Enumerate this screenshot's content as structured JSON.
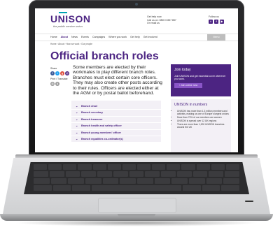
{
  "site": {
    "logo": "UNISON",
    "tagline": "the public service union",
    "help": {
      "title": "Get help now",
      "call": "Call us on: 0800 0 857 857",
      "email": "Or email us"
    },
    "follow_label": "Follow us",
    "social_icons": [
      "twitter-icon",
      "facebook-icon",
      "youtube-icon"
    ]
  },
  "nav": {
    "items": [
      "Home",
      "About",
      "News",
      "Events",
      "Campaigns",
      "Where you work",
      "Get help",
      "Get involved"
    ],
    "active": "About",
    "menu_label": "Menu"
  },
  "breadcrumb": [
    "Home",
    "About",
    "How we work",
    "Our people"
  ],
  "page": {
    "title": "Official branch roles",
    "share_label": "Share",
    "print_label": "Print / Translate",
    "intro": "Some members are elected by their workmates to play different branch roles. Branches must elect certain core officers. They may also create other posts according to their rules. Officers are elected either at the AGM or by postal ballot beforehand."
  },
  "accordion": [
    "Branch chair",
    "Branch secretary",
    "Branch treasurer",
    "Branch health and safety officer",
    "Branch young members' officer",
    "Branch equalities co-ordinator(s)"
  ],
  "join": {
    "title": "Join today",
    "text": "Join UNISON and get essential cover wherever you work.",
    "button": "Join online now"
  },
  "numbers": {
    "title": "UNISON in numbers",
    "items": [
      "UNISON has more than 1.3 million members and activists, making us one of Europe's largest unions",
      "More than 70% of our members are women",
      "UNISON is spread over 12 UK regions",
      "There are more than 1,000 UNISON branches around the UK"
    ]
  },
  "colors": {
    "brand_purple": "#4c2482",
    "accent_teal": "#00a4b3",
    "button_purple": "#8a55c8"
  }
}
